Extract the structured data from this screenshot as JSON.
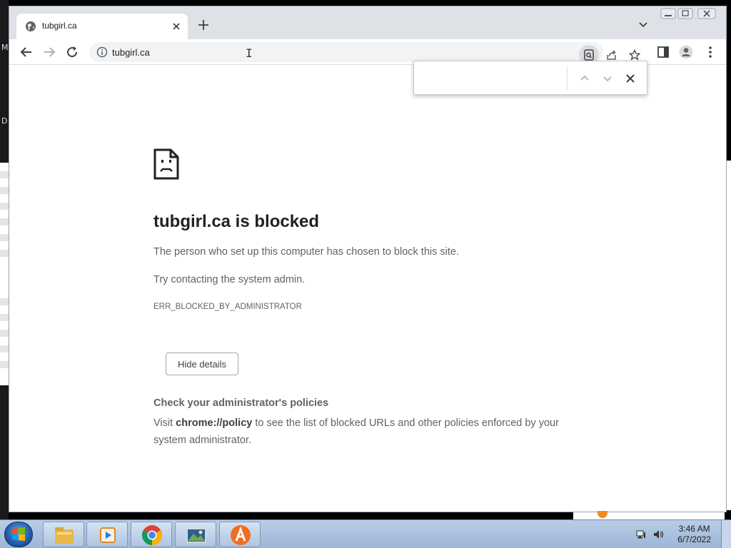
{
  "browser": {
    "tab_title": "tubgirl.ca",
    "url": "tubgirl.ca",
    "find_query": ""
  },
  "page": {
    "heading": "tubgirl.ca is blocked",
    "message": "The person who set up this computer has chosen to block this site.",
    "suggestion": "Try contacting the system admin.",
    "error_code": "ERR_BLOCKED_BY_ADMINISTRATOR",
    "details_button": "Hide details",
    "details_heading": "Check your administrator's policies",
    "details_visit": "Visit ",
    "details_link": "chrome://policy",
    "details_rest": " to see the list of blocked URLs and other policies enforced by your system administrator."
  },
  "taskbar": {
    "time": "3:46 AM",
    "date": "6/7/2022",
    "apps": [
      "windows-explorer-icon",
      "media-player-icon",
      "chrome-icon",
      "photo-viewer-icon",
      "avast-icon"
    ]
  },
  "desktop_letters": [
    "M",
    "D"
  ]
}
